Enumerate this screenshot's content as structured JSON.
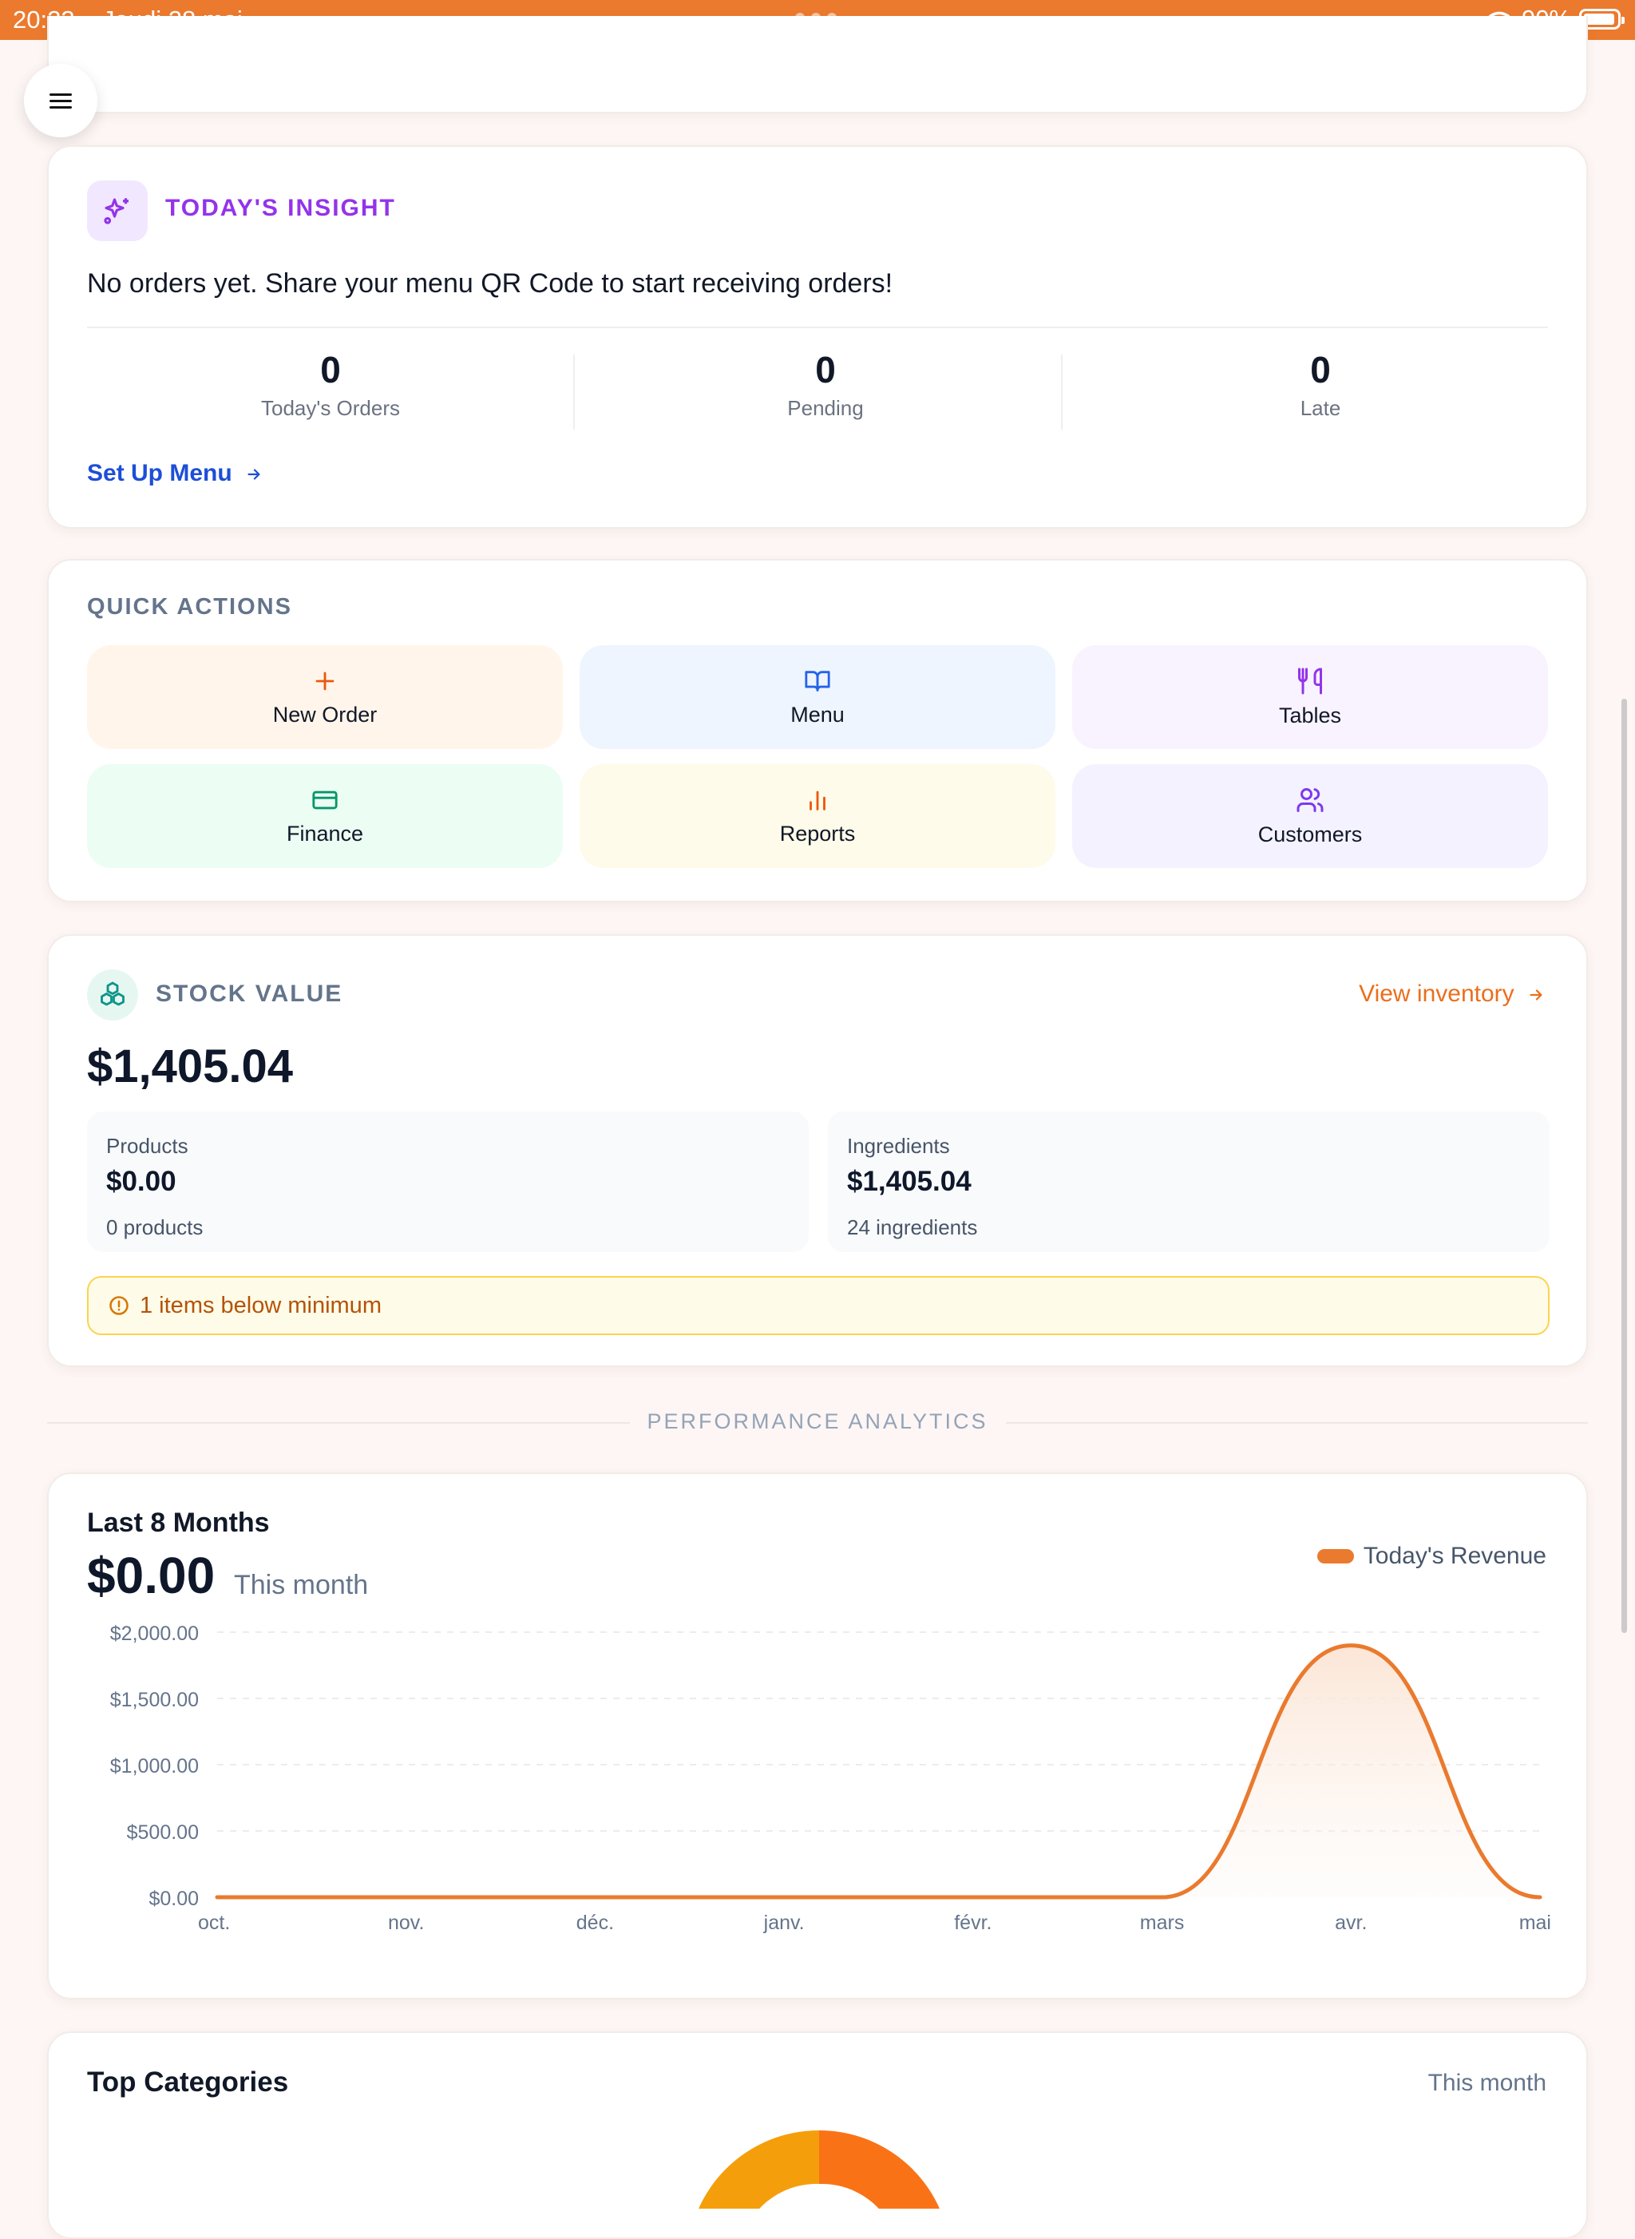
{
  "status_bar": {
    "time": "20:23",
    "date": "Jeudi 28 mai",
    "battery": "90%"
  },
  "insight": {
    "title": "TODAY'S INSIGHT",
    "message": "No orders yet. Share your menu QR Code to start receiving orders!",
    "stats": [
      {
        "value": "0",
        "label": "Today's Orders"
      },
      {
        "value": "0",
        "label": "Pending"
      },
      {
        "value": "0",
        "label": "Late"
      }
    ],
    "link": "Set Up Menu"
  },
  "quick_actions": {
    "title": "QUICK ACTIONS",
    "items": [
      {
        "label": "New Order",
        "icon": "plus-icon",
        "bg": "#fff5eb",
        "color": "#ea580c"
      },
      {
        "label": "Menu",
        "icon": "book-open-icon",
        "bg": "#eef5ff",
        "color": "#2563eb"
      },
      {
        "label": "Tables",
        "icon": "utensils-icon",
        "bg": "#f9f3ff",
        "color": "#9333ea"
      },
      {
        "label": "Finance",
        "icon": "credit-card-icon",
        "bg": "#ecfdf4",
        "color": "#059669"
      },
      {
        "label": "Reports",
        "icon": "bar-chart-icon",
        "bg": "#fefbea",
        "color": "#ea580c"
      },
      {
        "label": "Customers",
        "icon": "users-icon",
        "bg": "#f4f2ff",
        "color": "#7c3aed"
      }
    ]
  },
  "stock": {
    "title": "STOCK VALUE",
    "link": "View inventory",
    "value": "$1,405.04",
    "products": {
      "label": "Products",
      "value": "$0.00",
      "count": "0 products"
    },
    "ingredients": {
      "label": "Ingredients",
      "value": "$1,405.04",
      "count": "24 ingredients"
    },
    "warning": "1 items below minimum"
  },
  "section_label": "PERFORMANCE ANALYTICS",
  "revenue_chart": {
    "title": "Last 8 Months",
    "value": "$0.00",
    "value_caption": "This month",
    "legend": "Today's Revenue"
  },
  "chart_data": {
    "type": "area",
    "x": [
      "oct.",
      "nov.",
      "déc.",
      "janv.",
      "févr.",
      "mars",
      "avr.",
      "mai"
    ],
    "series": [
      {
        "name": "Today's Revenue",
        "values": [
          0,
          0,
          0,
          0,
          0,
          0,
          1900,
          0
        ]
      }
    ],
    "y_ticks": [
      "$2,000.00",
      "$1,500.00",
      "$1,000.00",
      "$500.00",
      "$0.00"
    ],
    "y_tick_values": [
      2000,
      1500,
      1000,
      500,
      0
    ],
    "ylim": [
      0,
      2000
    ],
    "grid": true,
    "legend_position": "top-right",
    "color": "#ea7a2e"
  },
  "top_categories": {
    "title": "Top Categories",
    "subtitle": "This month"
  }
}
